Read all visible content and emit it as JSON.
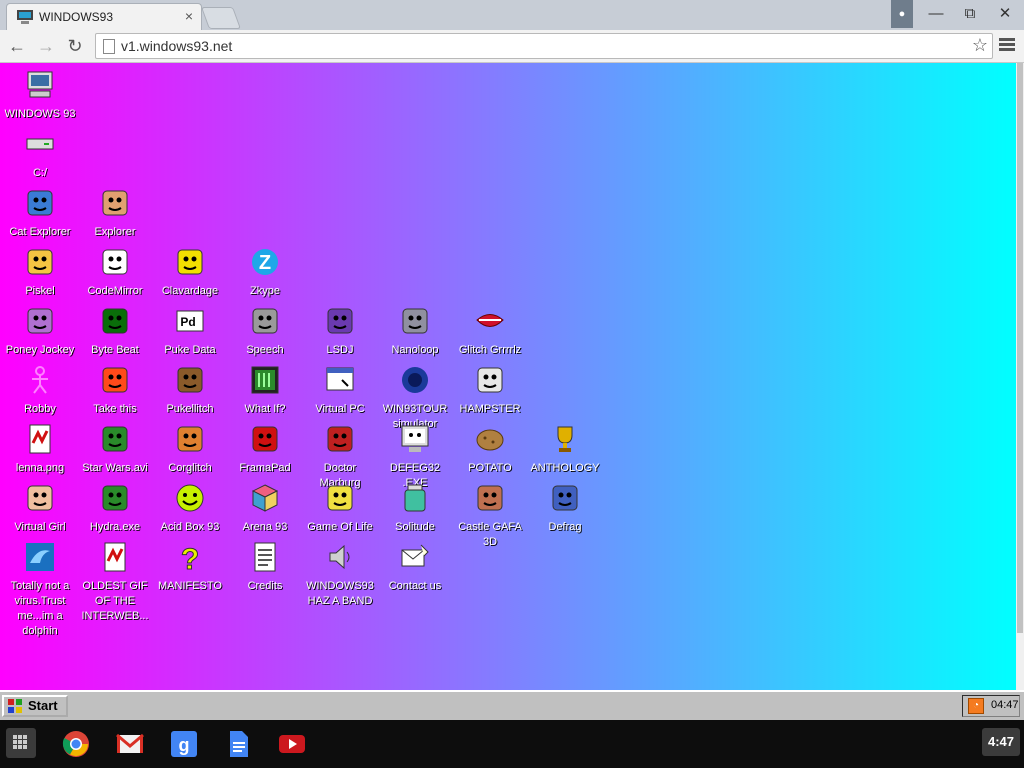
{
  "browser": {
    "tab_title": "WINDOWS93",
    "tab_close": "×",
    "url": "v1.windows93.net",
    "window_buttons": {
      "minimize": "—",
      "restore": "⧉",
      "close": "✕"
    }
  },
  "desktop": {
    "icons": [
      {
        "label": "WINDOWS 93",
        "icon": "computer-icon",
        "color": "#3a6ea5"
      },
      {
        "label": "C:/",
        "icon": "drive-icon",
        "color": "#c0c0c0"
      },
      {
        "label": "Cat Explorer",
        "icon": "cat-globe-icon",
        "color": "#3a7bd5"
      },
      {
        "label": "Explorer",
        "icon": "face-window-icon",
        "color": "#e0a070"
      },
      {
        "label": "Piskel",
        "icon": "palette-icon",
        "color": "#f4c542"
      },
      {
        "label": "CodeMirror",
        "icon": "unicorn-icon",
        "color": "#ffffff"
      },
      {
        "label": "Clavardage",
        "icon": "chat-face-icon",
        "color": "#f2e000"
      },
      {
        "label": "Zkype",
        "icon": "z-logo-icon",
        "color": "#1ea7e8"
      },
      {
        "label": "Poney Jockey",
        "icon": "pony-icon",
        "color": "#b070d0"
      },
      {
        "label": "Byte Beat",
        "icon": "byte-beat-icon",
        "color": "#0a6e0a"
      },
      {
        "label": "Puke Data",
        "icon": "pd-icon",
        "color": "#ffffff"
      },
      {
        "label": "Speech",
        "icon": "speech-face-icon",
        "color": "#9a9a9a"
      },
      {
        "label": "LSDJ",
        "icon": "gameboy-icon",
        "color": "#6a3ab0"
      },
      {
        "label": "Nanoloop",
        "icon": "nanoloop-icon",
        "color": "#9090a0"
      },
      {
        "label": "Glitch Grrrrlz",
        "icon": "lips-icon",
        "color": "#d0102a"
      },
      {
        "label": "Robby",
        "icon": "stickman-icon",
        "color": "#ff80ff"
      },
      {
        "label": "Take this",
        "icon": "wizard-icon",
        "color": "#ff4a1a"
      },
      {
        "label": "Pukellitch",
        "icon": "cookie-icon",
        "color": "#8a5a2a"
      },
      {
        "label": "What If?",
        "icon": "terminal-icon",
        "color": "#2a8a2a"
      },
      {
        "label": "Virtual PC",
        "icon": "window-icon",
        "color": "#4060c0"
      },
      {
        "label": "WIN93TOUR simulator",
        "icon": "blob-icon",
        "color": "#1a3a9a"
      },
      {
        "label": "HAMPSTER",
        "icon": "owl-icon",
        "color": "#e8e8e8"
      },
      {
        "label": "lenna.png",
        "icon": "image-file-icon",
        "color": "#d01010"
      },
      {
        "label": "Star Wars.avi",
        "icon": "yoda-icon",
        "color": "#2a8a2a"
      },
      {
        "label": "Corglitch",
        "icon": "corgi-icon",
        "color": "#e08030"
      },
      {
        "label": "FramaPad",
        "icon": "notepad-icon",
        "color": "#d01010"
      },
      {
        "label": "Doctor Marburg",
        "icon": "doctor-icon",
        "color": "#c02020"
      },
      {
        "label": "DEFEG32 .EXE",
        "icon": "monitor-face-icon",
        "color": "#9a9a9a"
      },
      {
        "label": "POTATO",
        "icon": "potato-icon",
        "color": "#b08040"
      },
      {
        "label": "ANTHOLOGY",
        "icon": "trophy-icon",
        "color": "#e0b000"
      },
      {
        "label": "Virtual Girl",
        "icon": "girl-face-icon",
        "color": "#f0c0a0"
      },
      {
        "label": "Hydra.exe",
        "icon": "hydra-icon",
        "color": "#2a8a2a"
      },
      {
        "label": "Acid Box 93",
        "icon": "smiley-icon",
        "color": "#c8f000"
      },
      {
        "label": "Arena 93",
        "icon": "cube-icon",
        "color": "#40a0d0"
      },
      {
        "label": "Game Of Life",
        "icon": "game-of-life-icon",
        "color": "#f0e040"
      },
      {
        "label": "Solitude",
        "icon": "jar-icon",
        "color": "#40c0a0"
      },
      {
        "label": "Castle GAFA 3D",
        "icon": "soldier-face-icon",
        "color": "#c07050"
      },
      {
        "label": "Defrag",
        "icon": "defrag-icon",
        "color": "#4060c0"
      },
      {
        "label": "Totally not a virus.Trust me...im a dolphin",
        "icon": "dolphin-icon",
        "color": "#30a0e0"
      },
      {
        "label": "OLDEST GIF OF THE INTERWEB...",
        "icon": "image-file-icon",
        "color": "#d01010"
      },
      {
        "label": "MANIFESTO",
        "icon": "question-icon",
        "color": "#e8f000"
      },
      {
        "label": "Credits",
        "icon": "document-icon",
        "color": "#ffffff"
      },
      {
        "label": "WINDOWS93 HAZ A BAND",
        "icon": "speaker-icon",
        "color": "#d0d0d0"
      },
      {
        "label": "Contact us",
        "icon": "letter-icon",
        "color": "#ffffff"
      }
    ]
  },
  "taskbar93": {
    "start_label": "Start",
    "clock": "04:47"
  },
  "shelf": {
    "apps": [
      {
        "name": "chrome-icon"
      },
      {
        "name": "gmail-icon"
      },
      {
        "name": "google-search-icon"
      },
      {
        "name": "docs-icon"
      },
      {
        "name": "youtube-icon"
      }
    ],
    "clock": "4:47"
  }
}
